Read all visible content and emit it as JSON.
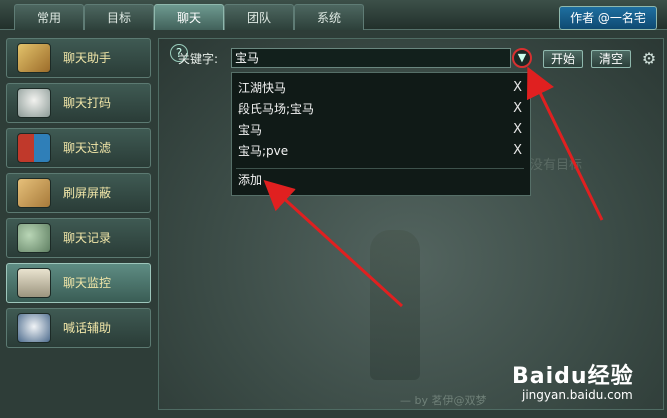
{
  "tabs": [
    {
      "label": "常用"
    },
    {
      "label": "目标"
    },
    {
      "label": "聊天"
    },
    {
      "label": "团队"
    },
    {
      "label": "系统"
    }
  ],
  "author_button": "作者 @一名宅",
  "sidebar": {
    "items": [
      {
        "label": "聊天助手",
        "icon": "quill-scroll-icon"
      },
      {
        "label": "聊天打码",
        "icon": "horse-head-icon"
      },
      {
        "label": "聊天过滤",
        "icon": "split-shield-icon"
      },
      {
        "label": "刷屏屏蔽",
        "icon": "parchment-icon"
      },
      {
        "label": "聊天记录",
        "icon": "orbs-icon"
      },
      {
        "label": "聊天监控",
        "icon": "lantern-icon"
      },
      {
        "label": "喊话辅助",
        "icon": "rabbit-icon"
      }
    ]
  },
  "keyword": {
    "label": "关键字:",
    "value": "宝马",
    "help": "?"
  },
  "buttons": {
    "start": "开始",
    "clear": "清空"
  },
  "dropdown": {
    "items": [
      "江湖快马",
      "段氏马场;宝马",
      "宝马",
      "宝马;pve"
    ],
    "remove": "X",
    "add": "添加"
  },
  "scene": {
    "ghost_text": "没有目标",
    "byline": "— by 茗伊@双梦"
  },
  "watermark": {
    "logo": "Baidu经验",
    "url": "jingyan.baidu.com"
  },
  "colors": {
    "accent": "#d83030",
    "active_tab": "#6e9a90",
    "author_bg": "#1e6fa0"
  }
}
